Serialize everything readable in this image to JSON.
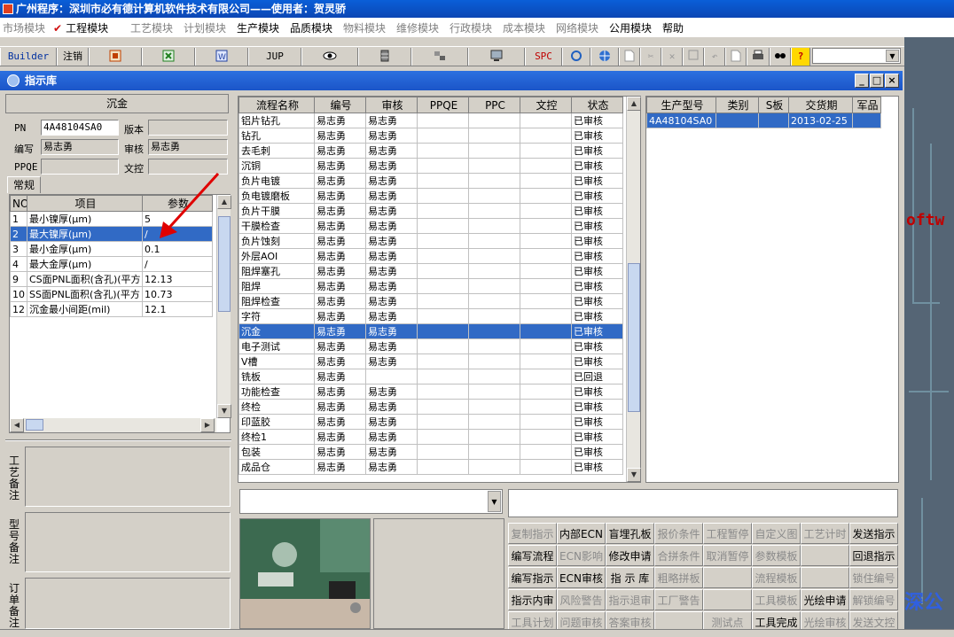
{
  "app": {
    "title": "广州程序：深圳市必有德计算机软件技术有限公司——使用者：贺灵骄"
  },
  "menu": [
    {
      "label": "市场模块",
      "enabled": false
    },
    {
      "label": "工程模块",
      "enabled": true
    },
    {
      "label": "工艺模块",
      "enabled": false
    },
    {
      "label": "计划模块",
      "enabled": false
    },
    {
      "label": "生产模块",
      "enabled": true
    },
    {
      "label": "品质模块",
      "enabled": true
    },
    {
      "label": "物料模块",
      "enabled": false
    },
    {
      "label": "维修模块",
      "enabled": false
    },
    {
      "label": "行政模块",
      "enabled": false
    },
    {
      "label": "成本模块",
      "enabled": false
    },
    {
      "label": "网络模块",
      "enabled": false
    },
    {
      "label": "公用模块",
      "enabled": true
    },
    {
      "label": "帮助",
      "enabled": true
    }
  ],
  "toolbar": {
    "builder": "Builder",
    "logout": "注销",
    "jup": "JUP",
    "spc": "SPC"
  },
  "window": {
    "title": "指示库",
    "min": "_",
    "max": "□",
    "close": "×"
  },
  "left": {
    "process_name": "沉金",
    "pn_label": "PN",
    "pn_value": "4A48104SA0",
    "version_label": "版本",
    "version_value": "",
    "author_label": "编写",
    "author_value": "易志勇",
    "review_label": "审核",
    "review_value": "易志勇",
    "ppqe_label": "PPQE",
    "ppqe_value": "",
    "control_label": "文控",
    "control_value": "",
    "tab": "常规",
    "param_headers": [
      "NO",
      "项目",
      "参数"
    ],
    "params": [
      {
        "no": "1",
        "item": "最小镍厚(μm)",
        "value": "5"
      },
      {
        "no": "2",
        "item": "最大镍厚(μm)",
        "value": "/"
      },
      {
        "no": "3",
        "item": "最小金厚(μm)",
        "value": "0.1"
      },
      {
        "no": "4",
        "item": "最大金厚(μm)",
        "value": "/"
      },
      {
        "no": "9",
        "item": "CS面PNL面积(含孔)(平方",
        "value": "12.13"
      },
      {
        "no": "10",
        "item": "SS面PNL面积(含孔)(平方",
        "value": "10.73"
      },
      {
        "no": "12",
        "item": "沉金最小间距(mil)",
        "value": "12.1"
      }
    ],
    "selected_param_index": 1,
    "notes": [
      "工艺备注",
      "型号备注",
      "订单备注"
    ]
  },
  "process_table": {
    "headers": [
      "流程名称",
      "编号",
      "审核",
      "PPQE",
      "PPC",
      "文控",
      "状态"
    ],
    "rows": [
      [
        "铝片钻孔",
        "易志勇",
        "易志勇",
        "",
        "",
        "",
        "已审核"
      ],
      [
        "钻孔",
        "易志勇",
        "易志勇",
        "",
        "",
        "",
        "已审核"
      ],
      [
        "去毛刺",
        "易志勇",
        "易志勇",
        "",
        "",
        "",
        "已审核"
      ],
      [
        "沉铜",
        "易志勇",
        "易志勇",
        "",
        "",
        "",
        "已审核"
      ],
      [
        "负片电镀",
        "易志勇",
        "易志勇",
        "",
        "",
        "",
        "已审核"
      ],
      [
        "负电镀磨板",
        "易志勇",
        "易志勇",
        "",
        "",
        "",
        "已审核"
      ],
      [
        "负片干膜",
        "易志勇",
        "易志勇",
        "",
        "",
        "",
        "已审核"
      ],
      [
        "干膜检查",
        "易志勇",
        "易志勇",
        "",
        "",
        "",
        "已审核"
      ],
      [
        "负片蚀刻",
        "易志勇",
        "易志勇",
        "",
        "",
        "",
        "已审核"
      ],
      [
        "外层AOI",
        "易志勇",
        "易志勇",
        "",
        "",
        "",
        "已审核"
      ],
      [
        "阻焊塞孔",
        "易志勇",
        "易志勇",
        "",
        "",
        "",
        "已审核"
      ],
      [
        "阻焊",
        "易志勇",
        "易志勇",
        "",
        "",
        "",
        "已审核"
      ],
      [
        "阻焊检查",
        "易志勇",
        "易志勇",
        "",
        "",
        "",
        "已审核"
      ],
      [
        "字符",
        "易志勇",
        "易志勇",
        "",
        "",
        "",
        "已审核"
      ],
      [
        "沉金",
        "易志勇",
        "易志勇",
        "",
        "",
        "",
        "已审核"
      ],
      [
        "电子测试",
        "易志勇",
        "易志勇",
        "",
        "",
        "",
        "已审核"
      ],
      [
        "V槽",
        "易志勇",
        "易志勇",
        "",
        "",
        "",
        "已审核"
      ],
      [
        "铣板",
        "易志勇",
        "",
        "",
        "",
        "",
        "已回退"
      ],
      [
        "功能检查",
        "易志勇",
        "易志勇",
        "",
        "",
        "",
        "已审核"
      ],
      [
        "终检",
        "易志勇",
        "易志勇",
        "",
        "",
        "",
        "已审核"
      ],
      [
        "印蓝胶",
        "易志勇",
        "易志勇",
        "",
        "",
        "",
        "已审核"
      ],
      [
        "终检1",
        "易志勇",
        "易志勇",
        "",
        "",
        "",
        "已审核"
      ],
      [
        "包装",
        "易志勇",
        "易志勇",
        "",
        "",
        "",
        "已审核"
      ],
      [
        "成品仓",
        "易志勇",
        "易志勇",
        "",
        "",
        "",
        "已审核"
      ]
    ],
    "selected_row_index": 14
  },
  "order_table": {
    "headers": [
      "生产型号",
      "类别",
      "S板",
      "交货期",
      "军品"
    ],
    "rows": [
      [
        "4A48104SA0",
        "",
        "",
        "2013-02-25",
        ""
      ]
    ]
  },
  "actions": [
    [
      "复制指示",
      "内部ECN",
      "盲埋孔板",
      "报价条件",
      "工程暂停",
      "自定义图",
      "工艺计时",
      "发送指示"
    ],
    [
      "编写流程",
      "ECN影响",
      "修改申请",
      "合拼条件",
      "取消暂停",
      "参数模板",
      "",
      "回退指示"
    ],
    [
      "编写指示",
      "ECN审核",
      "指 示 库",
      "粗略拼板",
      "",
      "流程模板",
      "",
      "锁住编号"
    ],
    [
      "指示内审",
      "风险警告",
      "指示退审",
      "工厂警告",
      "",
      "工具模板",
      "光绘申请",
      "解锁编号"
    ],
    [
      "工具计划",
      "问题审核",
      "答案审核",
      "",
      "测试点",
      "工具完成",
      "光绘审核",
      "发送文控"
    ]
  ],
  "actions_enabled": [
    [
      false,
      true,
      true,
      false,
      false,
      false,
      false,
      true
    ],
    [
      true,
      false,
      true,
      false,
      false,
      false,
      false,
      true
    ],
    [
      true,
      true,
      true,
      false,
      false,
      false,
      false,
      false
    ],
    [
      true,
      false,
      false,
      false,
      false,
      false,
      true,
      false
    ],
    [
      false,
      false,
      false,
      false,
      false,
      true,
      false,
      false
    ]
  ],
  "right_pane": {
    "text": "oftw",
    "logo": "深公"
  }
}
